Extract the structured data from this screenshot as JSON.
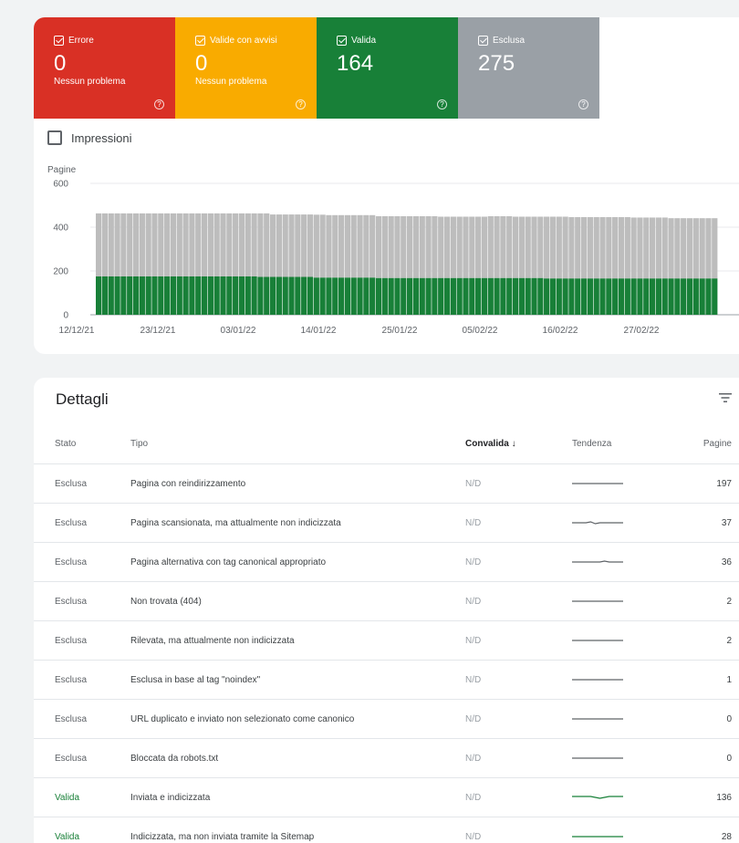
{
  "tiles": [
    {
      "label": "Errore",
      "value": "0",
      "sub": "Nessun problema",
      "color": "#d93025"
    },
    {
      "label": "Valide con avvisi",
      "value": "0",
      "sub": "Nessun problema",
      "color": "#f9ab00"
    },
    {
      "label": "Valida",
      "value": "164",
      "sub": "",
      "color": "#188038"
    },
    {
      "label": "Esclusa",
      "value": "275",
      "sub": "",
      "color": "#9aa0a6"
    }
  ],
  "impressioni_label": "Impressioni",
  "chart_data": {
    "type": "bar",
    "stacked": true,
    "ylabel": "Pagine",
    "ylim": [
      0,
      600
    ],
    "yticks": [
      "0",
      "200",
      "400",
      "600"
    ],
    "xtick_labels": [
      "12/12/21",
      "23/12/21",
      "03/01/22",
      "14/01/22",
      "25/01/22",
      "05/02/22",
      "16/02/22",
      "27/02/22"
    ],
    "series": [
      {
        "color": "#188038",
        "values": [
          175,
          175,
          175,
          175,
          175,
          175,
          175,
          175,
          175,
          175,
          175,
          175,
          175,
          175,
          175,
          175,
          175,
          175,
          175,
          175,
          175,
          175,
          175,
          175,
          175,
          175,
          173,
          173,
          173,
          173,
          173,
          173,
          173,
          173,
          173,
          170,
          170,
          170,
          170,
          170,
          170,
          170,
          170,
          170,
          170,
          168,
          168,
          168,
          168,
          168,
          168,
          168,
          168,
          168,
          168,
          168,
          168,
          168,
          168,
          168,
          168,
          168,
          168,
          168,
          168,
          168,
          168,
          168,
          168,
          168,
          168,
          168,
          166,
          166,
          166,
          166,
          166,
          166,
          166,
          166,
          166,
          166,
          166,
          166,
          166,
          166,
          166,
          166,
          166,
          166,
          166,
          166,
          166,
          166,
          166,
          166,
          166,
          166,
          166,
          166
        ]
      },
      {
        "color": "#bdbdbd",
        "values": [
          288,
          288,
          288,
          288,
          288,
          288,
          288,
          288,
          288,
          288,
          288,
          288,
          288,
          288,
          288,
          288,
          288,
          288,
          288,
          288,
          288,
          288,
          288,
          288,
          288,
          288,
          290,
          290,
          285,
          285,
          285,
          285,
          285,
          285,
          285,
          287,
          287,
          285,
          285,
          285,
          285,
          285,
          285,
          285,
          285,
          282,
          282,
          282,
          282,
          282,
          282,
          282,
          282,
          282,
          282,
          280,
          280,
          280,
          280,
          280,
          280,
          280,
          280,
          282,
          282,
          282,
          282,
          280,
          280,
          280,
          280,
          280,
          282,
          282,
          282,
          282,
          280,
          280,
          280,
          280,
          280,
          280,
          280,
          280,
          280,
          280,
          278,
          278,
          278,
          278,
          278,
          278,
          275,
          275,
          275,
          275,
          275,
          275,
          275,
          275
        ]
      }
    ]
  },
  "details": {
    "title": "Dettagli",
    "columns": {
      "stato": "Stato",
      "tipo": "Tipo",
      "convalida": "Convalida",
      "tendenza": "Tendenza",
      "pagine": "Pagine"
    },
    "rows": [
      {
        "stato": "Esclusa",
        "tipo": "Pagina con reindirizzamento",
        "convalida": "N/D",
        "pagine": "197",
        "trend_color": "#5f6368",
        "trend": [
          5,
          5,
          5,
          5,
          5,
          5,
          5,
          5,
          5,
          5,
          5,
          5
        ]
      },
      {
        "stato": "Esclusa",
        "tipo": "Pagina scansionata, ma attualmente non indicizzata",
        "convalida": "N/D",
        "pagine": "37",
        "trend_color": "#5f6368",
        "trend": [
          5,
          5,
          5,
          5,
          4,
          6,
          5,
          5,
          5,
          5,
          5,
          5
        ]
      },
      {
        "stato": "Esclusa",
        "tipo": "Pagina alternativa con tag canonical appropriato",
        "convalida": "N/D",
        "pagine": "36",
        "trend_color": "#5f6368",
        "trend": [
          5,
          5,
          5,
          5,
          5,
          5,
          5,
          4,
          5,
          5,
          5,
          5
        ]
      },
      {
        "stato": "Esclusa",
        "tipo": "Non trovata (404)",
        "convalida": "N/D",
        "pagine": "2",
        "trend_color": "#5f6368",
        "trend": [
          5,
          5,
          5,
          5,
          5,
          5,
          5,
          5,
          5,
          5,
          5,
          5
        ]
      },
      {
        "stato": "Esclusa",
        "tipo": "Rilevata, ma attualmente non indicizzata",
        "convalida": "N/D",
        "pagine": "2",
        "trend_color": "#5f6368",
        "trend": [
          5,
          5,
          5,
          5,
          5,
          5,
          5,
          5,
          5,
          5,
          5,
          5
        ]
      },
      {
        "stato": "Esclusa",
        "tipo": "Esclusa in base al tag \"noindex\"",
        "convalida": "N/D",
        "pagine": "1",
        "trend_color": "#5f6368",
        "trend": [
          5,
          5,
          5,
          5,
          5,
          5,
          5,
          5,
          5,
          5,
          5,
          5
        ]
      },
      {
        "stato": "Esclusa",
        "tipo": "URL duplicato e inviato non selezionato come canonico",
        "convalida": "N/D",
        "pagine": "0",
        "trend_color": "#5f6368",
        "trend": [
          5,
          5,
          5,
          5,
          5,
          5,
          5,
          5,
          5,
          5,
          5,
          5
        ]
      },
      {
        "stato": "Esclusa",
        "tipo": "Bloccata da robots.txt",
        "convalida": "N/D",
        "pagine": "0",
        "trend_color": "#5f6368",
        "trend": [
          5,
          5,
          5,
          5,
          5,
          5,
          5,
          5,
          5,
          5,
          5,
          5
        ]
      },
      {
        "stato": "Valida",
        "tipo": "Inviata e indicizzata",
        "convalida": "N/D",
        "pagine": "136",
        "trend_color": "#188038",
        "trend": [
          4,
          4,
          4,
          4,
          4,
          5,
          6,
          5,
          4,
          4,
          4,
          4
        ]
      },
      {
        "stato": "Valida",
        "tipo": "Indicizzata, ma non inviata tramite la Sitemap",
        "convalida": "N/D",
        "pagine": "28",
        "trend_color": "#188038",
        "trend": [
          5,
          5,
          5,
          5,
          5,
          5,
          5,
          5,
          5,
          5,
          5,
          5
        ]
      }
    ]
  }
}
